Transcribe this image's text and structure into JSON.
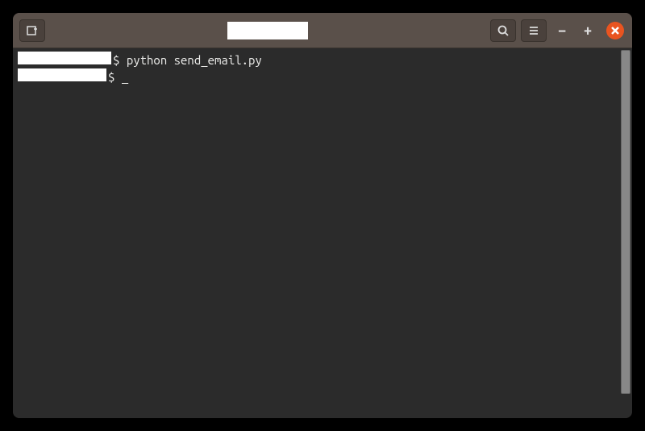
{
  "titlebar": {
    "title_field_value": ""
  },
  "terminal": {
    "lines": [
      {
        "prompt_symbol": "$",
        "command": "python send_email.py"
      },
      {
        "prompt_symbol": "$",
        "command": "_"
      }
    ]
  },
  "icons": {
    "new_tab": "new-tab-icon",
    "search": "search-icon",
    "menu": "hamburger-icon",
    "minimize": "−",
    "maximize": "+",
    "close": "close-icon"
  }
}
